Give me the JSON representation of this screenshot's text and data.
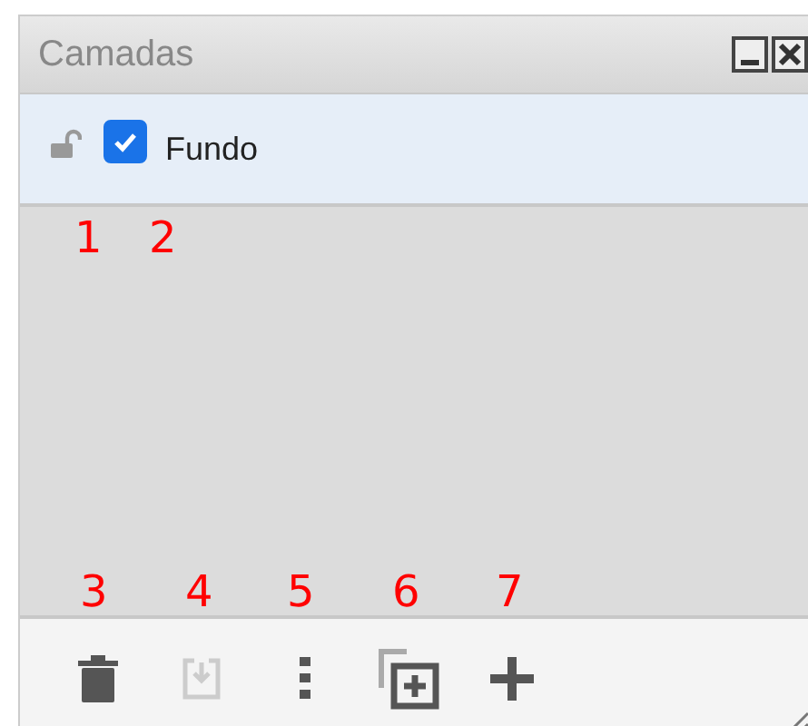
{
  "panel": {
    "title": "Camadas"
  },
  "layers": [
    {
      "name": "Fundo",
      "locked": false,
      "visible": true
    }
  ],
  "toolbar": [
    {
      "kind": "delete",
      "disabled": false
    },
    {
      "kind": "export",
      "disabled": true
    },
    {
      "kind": "more",
      "disabled": false
    },
    {
      "kind": "duplicate",
      "disabled": false
    },
    {
      "kind": "add",
      "disabled": false
    }
  ],
  "annotations": [
    "1",
    "2",
    "3",
    "4",
    "5",
    "6",
    "7"
  ]
}
